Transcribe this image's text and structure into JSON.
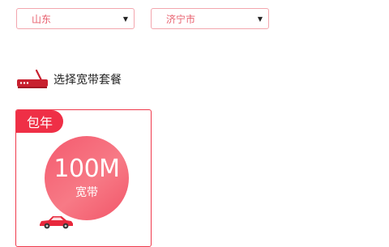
{
  "filters": {
    "province": {
      "value": "山东"
    },
    "city": {
      "value": "济宁市"
    }
  },
  "section": {
    "title": "选择宽带套餐",
    "icon": "router-icon"
  },
  "plans": [
    {
      "badge": "包年",
      "speed": "100M",
      "type": "宽带",
      "icon": "car-icon"
    }
  ],
  "colors": {
    "accent": "#ef2f46",
    "border_light": "#f3a6ae",
    "circle": "#f45a6e"
  }
}
